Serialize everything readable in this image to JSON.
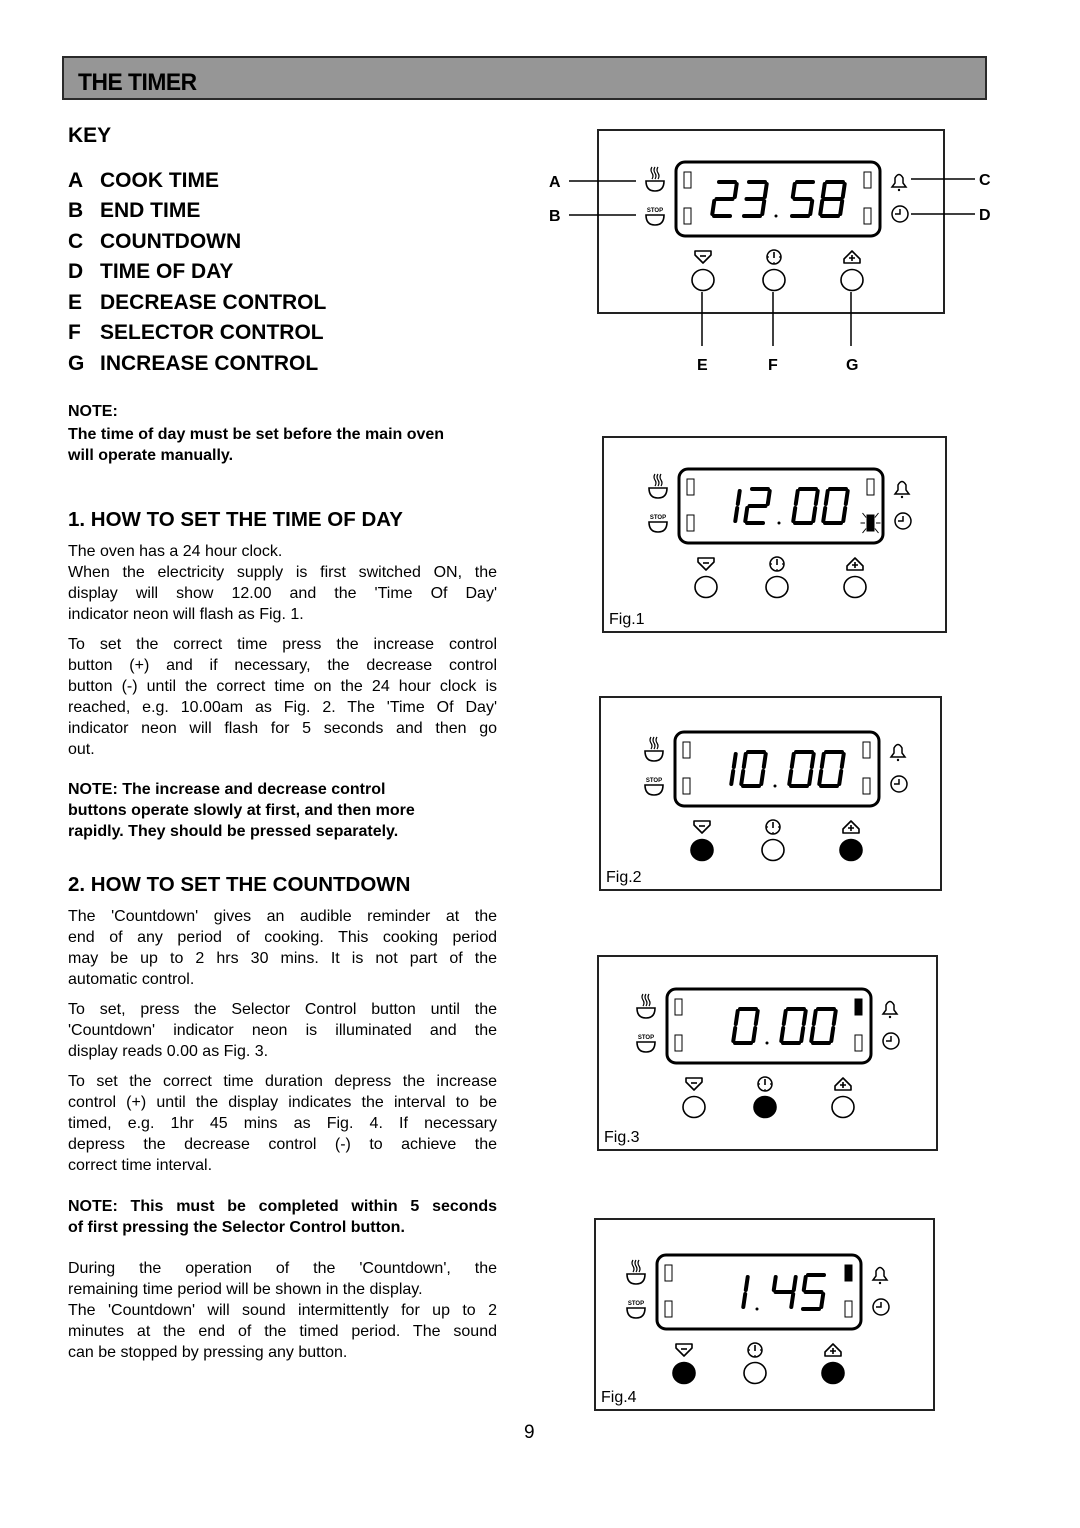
{
  "page": {
    "title": "THE TIMER",
    "page_number": "9"
  },
  "key": {
    "heading": "KEY",
    "items": [
      {
        "letter": "A",
        "label": "COOK TIME"
      },
      {
        "letter": "B",
        "label": "END TIME"
      },
      {
        "letter": "C",
        "label": "COUNTDOWN"
      },
      {
        "letter": "D",
        "label": "TIME OF DAY"
      },
      {
        "letter": "E",
        "label": "DECREASE CONTROL"
      },
      {
        "letter": "F",
        "label": "SELECTOR CONTROL"
      },
      {
        "letter": "G",
        "label": "INCREASE CONTROL"
      }
    ]
  },
  "note1": {
    "label": "NOTE:",
    "lines": [
      "The time of day must be set before the main oven",
      "will operate manually."
    ]
  },
  "section1": {
    "heading": "1.  HOW TO SET THE TIME OF DAY",
    "para1": [
      "The oven has a 24 hour clock.",
      "When the electricity supply is first switched ON, the",
      "display will show 12.00 and the 'Time Of Day'",
      "indicator neon will flash as Fig. 1."
    ],
    "para2": [
      "To set the correct time press the increase control",
      "button (+) and if necessary, the decrease control",
      "button (-) until the correct time on the 24 hour clock is",
      "reached, e.g. 10.00am as Fig. 2.  The 'Time Of Day'",
      "indicator neon will flash for 5 seconds and then go",
      "out."
    ],
    "note": [
      "NOTE:  The increase and decrease control",
      "buttons operate slowly at first, and then more",
      "rapidly.  They should be pressed separately."
    ]
  },
  "section2": {
    "heading": "2.  HOW TO SET THE COUNTDOWN",
    "para1": [
      "The 'Countdown' gives an audible reminder at the",
      "end of any period of cooking.  This cooking period",
      "may be  up to 2 hrs 30 mins.  It is not part of the",
      "automatic control."
    ],
    "para2": [
      "To set, press the Selector Control button until the",
      "'Countdown' indicator neon is illuminated and the",
      "display reads 0.00 as Fig. 3."
    ],
    "para3": [
      "To set the correct time duration depress the increase",
      "control (+) until the display indicates the interval to be",
      "timed, e.g. 1hr 45 mins as Fig. 4.  If necessary",
      "depress the decrease control (-) to achieve the",
      "correct time interval."
    ],
    "note": [
      "NOTE:  This must be completed within 5 seconds",
      "of first pressing the Selector Control button."
    ],
    "para4": [
      "During the operation of the 'Countdown', the",
      "remaining time period will be shown in the display.",
      "The 'Countdown' will sound intermittently for up to 2",
      "minutes at the end of the timed period.  The sound",
      "can be stopped by pressing any button."
    ]
  },
  "diagram_key": {
    "display": "23.58",
    "callouts": {
      "left": [
        "A",
        "B"
      ],
      "right": [
        "C",
        "D"
      ],
      "bottom": [
        "E",
        "F",
        "G"
      ]
    },
    "indicators": {
      "cook_time": "off",
      "end_time": "off",
      "countdown": "off",
      "time_of_day": "off"
    },
    "buttons": {
      "decrease": "released",
      "selector": "released",
      "increase": "released"
    },
    "icons": {
      "cook_time": "steaming-pot-icon",
      "end_time": "stop-pot-icon",
      "countdown": "bell-icon",
      "time_of_day": "clock-icon",
      "decrease": "minus-triangle-icon",
      "selector": "selector-clock-icon",
      "increase": "plus-triangle-icon"
    },
    "stop_text": "STOP"
  },
  "figures": [
    {
      "caption": "Fig.1",
      "display": "12.00",
      "indicators": {
        "cook_time": "off",
        "end_time": "off",
        "countdown": "off",
        "time_of_day": "flashing"
      },
      "buttons": {
        "decrease": "released",
        "selector": "released",
        "increase": "released"
      }
    },
    {
      "caption": "Fig.2",
      "display": "10.00",
      "indicators": {
        "cook_time": "off",
        "end_time": "off",
        "countdown": "off",
        "time_of_day": "off"
      },
      "buttons": {
        "decrease": "pressed",
        "selector": "released",
        "increase": "pressed"
      }
    },
    {
      "caption": "Fig.3",
      "display": "0.00",
      "indicators": {
        "cook_time": "off",
        "end_time": "off",
        "countdown": "on",
        "time_of_day": "off"
      },
      "buttons": {
        "decrease": "released",
        "selector": "pressed",
        "increase": "released"
      }
    },
    {
      "caption": "Fig.4",
      "display": "1.45",
      "indicators": {
        "cook_time": "off",
        "end_time": "off",
        "countdown": "on",
        "time_of_day": "off"
      },
      "buttons": {
        "decrease": "pressed",
        "selector": "released",
        "increase": "pressed"
      }
    }
  ],
  "colors": {
    "title_bar": "#969696",
    "ink": "#000000",
    "paper": "#ffffff"
  }
}
